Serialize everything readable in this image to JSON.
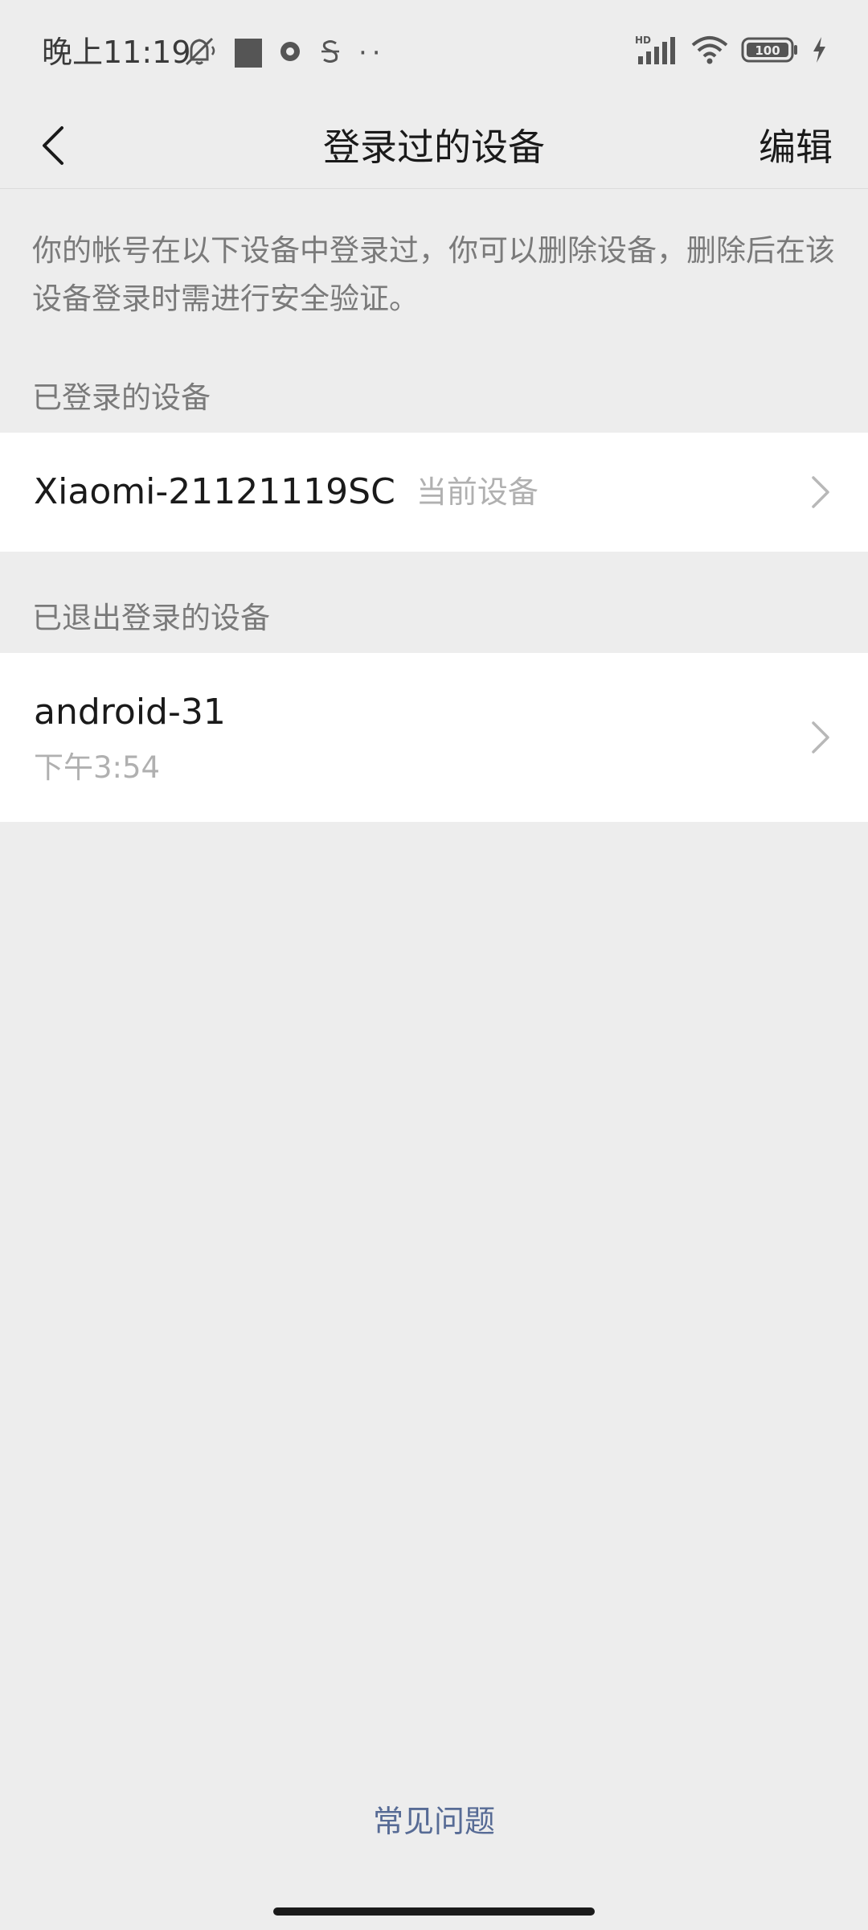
{
  "status_bar": {
    "time": "晚上11:19",
    "battery": "100",
    "network": "HD",
    "left_icons": [
      "mute-icon",
      "app-square-icon",
      "circle-app-icon",
      "s-app-icon",
      "more-dots-icon"
    ],
    "right_icons": [
      "hd-signal-icon",
      "wifi-icon",
      "battery-icon",
      "charging-icon"
    ]
  },
  "header": {
    "title": "登录过的设备",
    "edit_label": "编辑",
    "back_icon": "chevron-left-icon"
  },
  "description": "你的帐号在以下设备中登录过，你可以删除设备，删除后在该设备登录时需进行安全验证。",
  "logged_in": {
    "section_label": "已登录的设备",
    "devices": [
      {
        "name": "Xiaomi-21121119SC",
        "tag": "当前设备"
      }
    ]
  },
  "logged_out": {
    "section_label": "已退出登录的设备",
    "devices": [
      {
        "name": "android-31",
        "time": "下午3:54"
      }
    ]
  },
  "footer": {
    "faq_label": "常见问题"
  },
  "colors": {
    "background": "#ededed",
    "card": "#ffffff",
    "link": "#576b95",
    "secondary_text": "#7a7a7a",
    "tertiary_text": "#b0b0b0"
  }
}
